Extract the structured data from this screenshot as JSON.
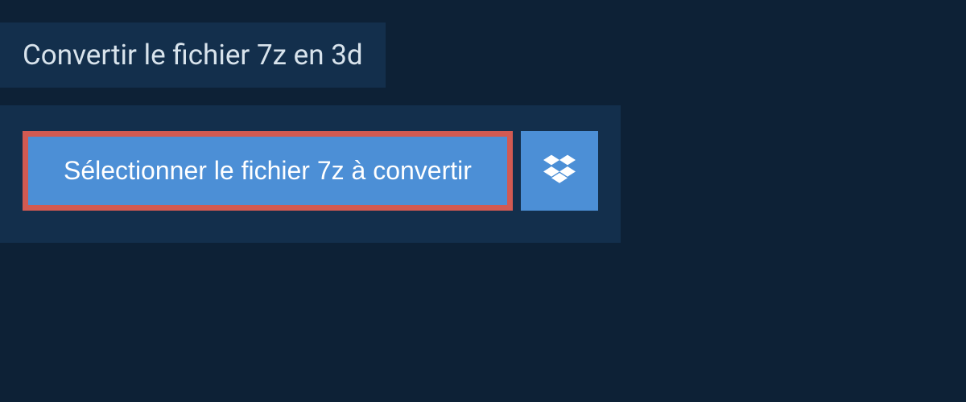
{
  "header": {
    "title": "Convertir le fichier 7z en 3d"
  },
  "actions": {
    "select_file_label": "Sélectionner le fichier 7z à convertir"
  },
  "colors": {
    "bg_dark": "#0d2136",
    "panel": "#132f4c",
    "button": "#4c8fd6",
    "highlight_border": "#d25a52",
    "text_light": "#d8e3ec"
  }
}
